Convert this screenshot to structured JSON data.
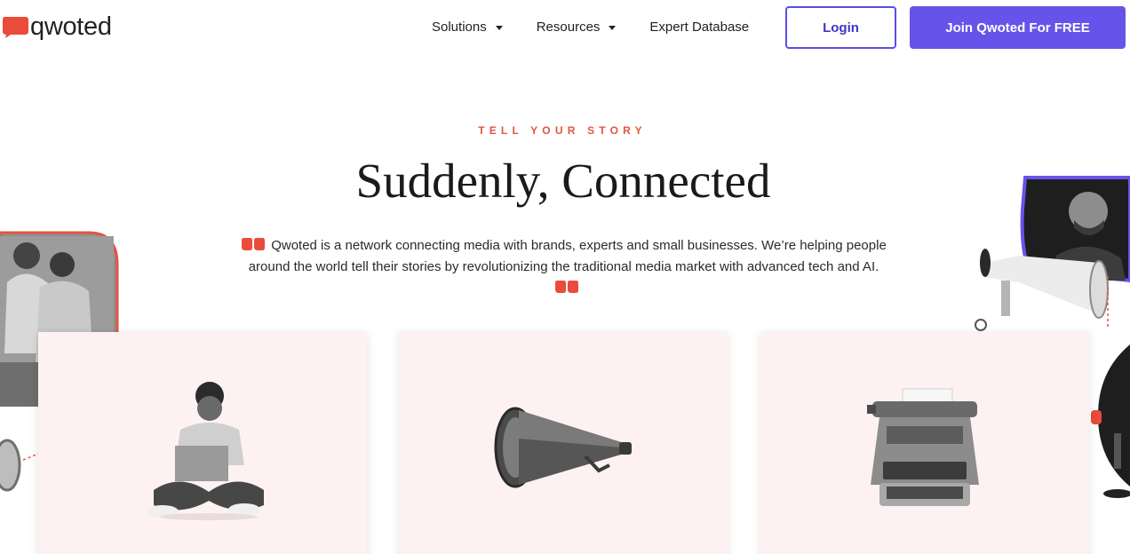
{
  "header": {
    "logo_text": "qwoted",
    "nav": [
      {
        "label": "Solutions",
        "has_dropdown": true
      },
      {
        "label": "Resources",
        "has_dropdown": true
      },
      {
        "label": "Expert Database",
        "has_dropdown": false
      }
    ],
    "login_label": "Login",
    "join_label": "Join Qwoted For FREE"
  },
  "hero": {
    "eyebrow": "TELL YOUR STORY",
    "headline": "Suddenly, Connected",
    "intro": "Qwoted is a network connecting media with brands, experts and small businesses. We’re helping people around the world tell their stories by revolutionizing the traditional media market with advanced tech and AI."
  },
  "colors": {
    "accent_red": "#e5553f",
    "brand_purple": "#6654ea",
    "card_bg": "#fdf2f1"
  },
  "icons": [
    "quote-open-icon",
    "quote-close-icon",
    "caret-down-icon"
  ]
}
